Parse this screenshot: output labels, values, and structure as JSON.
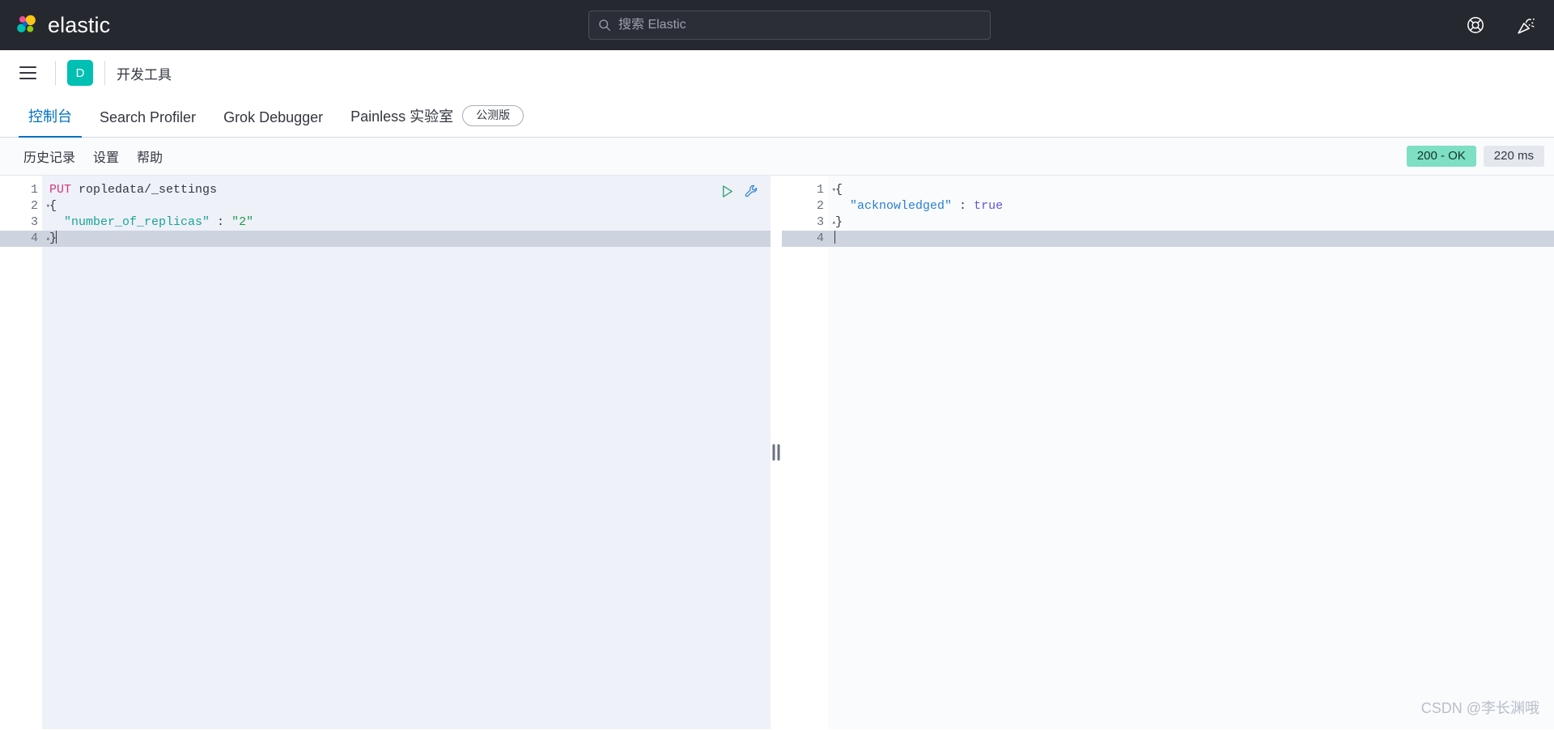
{
  "header": {
    "brand": "elastic",
    "logo_colors": {
      "pink": "#ef5098",
      "yellow": "#fec514",
      "teal": "#00bfb3",
      "green": "#93c90e",
      "blue": "#0b64dd"
    },
    "search": {
      "placeholder": "搜索 Elastic",
      "value": ""
    },
    "icons": [
      {
        "name": "help-icon",
        "glyph": "lifebuoy"
      },
      {
        "name": "whats-new-icon",
        "glyph": "party-popper"
      }
    ],
    "background": "#25282f"
  },
  "nav": {
    "menu_label": "菜单",
    "space_badge": "D",
    "space_badge_color": "#00bfb3",
    "breadcrumb": "开发工具"
  },
  "tabs": [
    {
      "label": "控制台",
      "active": true,
      "badge": null
    },
    {
      "label": "Search Profiler",
      "active": false,
      "badge": null
    },
    {
      "label": "Grok Debugger",
      "active": false,
      "badge": null
    },
    {
      "label": "Painless 实验室",
      "active": false,
      "badge": "公测版"
    }
  ],
  "console_toolbar": {
    "links": [
      "历史记录",
      "设置",
      "帮助"
    ],
    "status": "200 - OK",
    "status_color": "#7ddfc3",
    "duration": "220 ms"
  },
  "request_editor": {
    "name": "console-request-editor",
    "actions": [
      {
        "name": "send-request-button",
        "glyph": "play"
      },
      {
        "name": "wrench-menu-button",
        "glyph": "wrench"
      }
    ],
    "lines": [
      {
        "n": "1",
        "fold": "",
        "active": false,
        "tokens": [
          {
            "t": "PUT",
            "c": "tok-method"
          },
          {
            "t": " ropledata/_settings",
            "c": "tok-url"
          }
        ]
      },
      {
        "n": "2",
        "fold": "▾",
        "active": false,
        "tokens": [
          {
            "t": "{",
            "c": "tok-punc"
          }
        ]
      },
      {
        "n": "3",
        "fold": "",
        "active": false,
        "tokens": [
          {
            "t": "  ",
            "c": "tok-punc"
          },
          {
            "t": "\"number_of_replicas\"",
            "c": "tok-key"
          },
          {
            "t": " : ",
            "c": "tok-punc"
          },
          {
            "t": "\"2\"",
            "c": "tok-str"
          }
        ]
      },
      {
        "n": "4",
        "fold": "▴",
        "active": true,
        "tokens": [
          {
            "t": "}",
            "c": "tok-punc"
          }
        ]
      }
    ]
  },
  "response_editor": {
    "name": "console-response-editor",
    "lines": [
      {
        "n": "1",
        "fold": "▾",
        "active": false,
        "tokens": [
          {
            "t": "{",
            "c": "tok-punc"
          }
        ]
      },
      {
        "n": "2",
        "fold": "",
        "active": false,
        "tokens": [
          {
            "t": "  ",
            "c": "tok-punc"
          },
          {
            "t": "\"acknowledged\"",
            "c": "tok-rkey"
          },
          {
            "t": " : ",
            "c": "tok-punc"
          },
          {
            "t": "true",
            "c": "tok-bool"
          }
        ]
      },
      {
        "n": "3",
        "fold": "▴",
        "active": false,
        "tokens": [
          {
            "t": "}",
            "c": "tok-punc"
          }
        ]
      },
      {
        "n": "4",
        "fold": "",
        "active": true,
        "tokens": []
      }
    ]
  },
  "splitter": {
    "name": "editor-splitter"
  },
  "watermark": "CSDN @李长渊哦"
}
